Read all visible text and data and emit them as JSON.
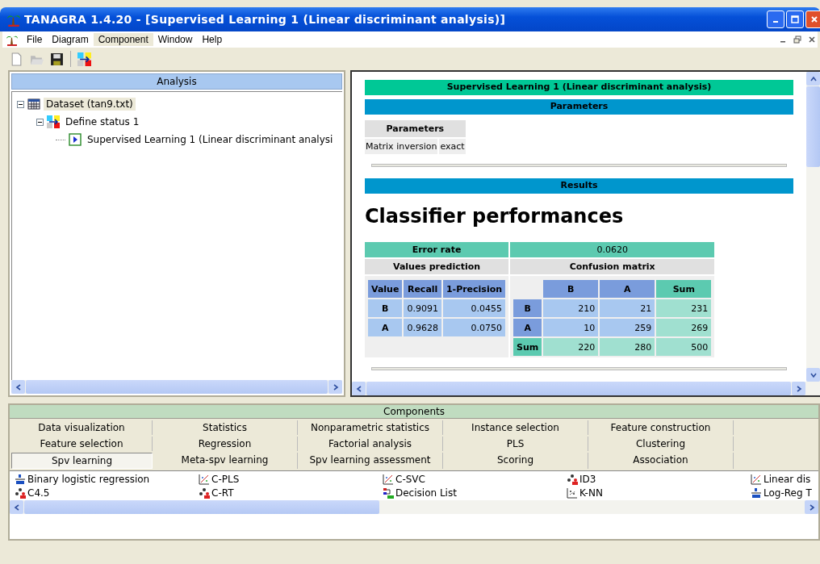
{
  "window": {
    "title": "TANAGRA 1.4.20 - [Supervised Learning 1 (Linear discriminant analysis)]"
  },
  "menu": [
    {
      "label": "File",
      "selected": false
    },
    {
      "label": "Diagram",
      "selected": false
    },
    {
      "label": "Component",
      "selected": true
    },
    {
      "label": "Window",
      "selected": false
    },
    {
      "label": "Help",
      "selected": false
    }
  ],
  "analysis": {
    "title": "Analysis",
    "tree": [
      {
        "label": "Dataset (tan9.txt)",
        "kind": "dataset",
        "selected": true,
        "expanded": true,
        "children": [
          {
            "label": "Define status 1",
            "kind": "status",
            "selected": false,
            "expanded": true,
            "children": [
              {
                "label": "Supervised Learning 1 (Linear discriminant analysi",
                "kind": "learner",
                "selected": false
              }
            ]
          }
        ]
      }
    ]
  },
  "report": {
    "title": "Supervised Learning 1 (Linear discriminant analysis)",
    "parameters_header": "Parameters",
    "parameters_table": {
      "header": "Parameters",
      "rows": [
        {
          "name": "Matrix inversion",
          "value": "exact"
        }
      ]
    },
    "results_header": "Results",
    "heading": "Classifier performances",
    "error_rate": {
      "label": "Error rate",
      "value": "0.0620"
    },
    "values_prediction": {
      "title": "Values prediction",
      "columns": [
        "Value",
        "Recall",
        "1-Precision"
      ],
      "rows": [
        {
          "value": "B",
          "recall": "0.9091",
          "precision": "0.0455"
        },
        {
          "value": "A",
          "recall": "0.9628",
          "precision": "0.0750"
        }
      ]
    },
    "confusion_matrix": {
      "title": "Confusion matrix",
      "columns": [
        "B",
        "A",
        "Sum"
      ],
      "rows": [
        {
          "label": "B",
          "cells": [
            "210",
            "21"
          ],
          "sum": "231"
        },
        {
          "label": "A",
          "cells": [
            "10",
            "259"
          ],
          "sum": "269"
        }
      ],
      "sum_row": {
        "label": "Sum",
        "cells": [
          "220",
          "280"
        ],
        "sum": "500"
      }
    }
  },
  "components": {
    "title": "Components",
    "tabs": [
      [
        {
          "label": "Data visualization",
          "selected": false
        },
        {
          "label": "Statistics",
          "selected": false
        },
        {
          "label": "Nonparametric statistics",
          "selected": false
        },
        {
          "label": "Instance selection",
          "selected": false
        },
        {
          "label": "Feature construction",
          "selected": false
        }
      ],
      [
        {
          "label": "Feature selection",
          "selected": false
        },
        {
          "label": "Regression",
          "selected": false
        },
        {
          "label": "Factorial analysis",
          "selected": false
        },
        {
          "label": "PLS",
          "selected": false
        },
        {
          "label": "Clustering",
          "selected": false
        }
      ],
      [
        {
          "label": "Spv learning",
          "selected": true
        },
        {
          "label": "Meta-spv learning",
          "selected": false
        },
        {
          "label": "Spv learning assessment",
          "selected": false
        },
        {
          "label": "Scoring",
          "selected": false
        },
        {
          "label": "Association",
          "selected": false
        }
      ]
    ],
    "items": [
      [
        {
          "label": "Binary logistic regression",
          "kind": "logistic"
        },
        {
          "label": "C-PLS",
          "kind": "scatter"
        },
        {
          "label": "C-SVC",
          "kind": "scatter"
        },
        {
          "label": "ID3",
          "kind": "tree"
        },
        {
          "label": "Linear dis",
          "kind": "scatter"
        }
      ],
      [
        {
          "label": "C4.5",
          "kind": "tree"
        },
        {
          "label": "C-RT",
          "kind": "tree"
        },
        {
          "label": "Decision List",
          "kind": "list"
        },
        {
          "label": "K-NN",
          "kind": "points"
        },
        {
          "label": "Log-Reg T",
          "kind": "logistic"
        }
      ]
    ]
  }
}
